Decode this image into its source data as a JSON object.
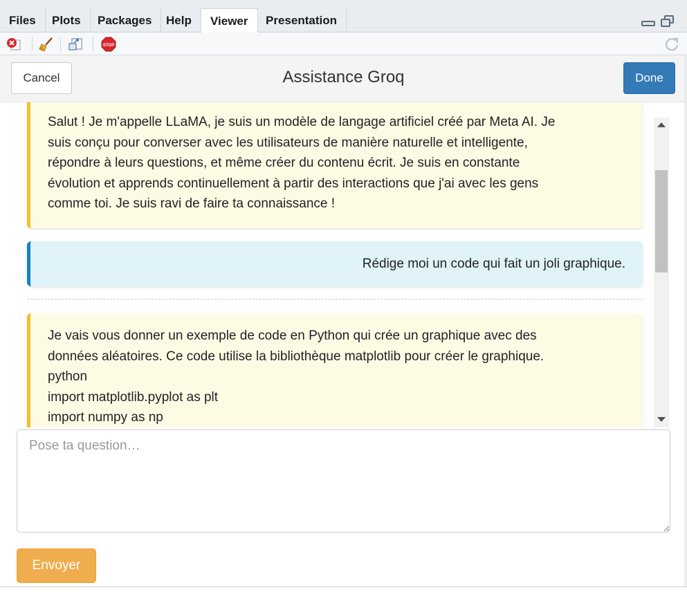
{
  "pane_tabs": [
    "Files",
    "Plots",
    "Packages",
    "Help",
    "Viewer",
    "Presentation"
  ],
  "active_tab": "Viewer",
  "toolbar": {
    "icons": [
      "close-viewer-icon",
      "broom-icon",
      "export-icon",
      "stop-icon",
      "refresh-icon"
    ],
    "stop_label": "STOP"
  },
  "modal": {
    "cancel_label": "Cancel",
    "title": "Assistance Groq",
    "done_label": "Done"
  },
  "messages": [
    {
      "role": "assistant",
      "lines": [
        "Salut ! Je m'appelle LLaMA, je suis un modèle de langage artificiel créé par Meta AI. Je",
        "suis conçu pour converser avec les utilisateurs de manière naturelle et intelligente,",
        "répondre à leurs questions, et même créer du contenu écrit. Je suis en constante",
        "évolution et apprends continuellement à partir des interactions que j'ai avec les gens",
        "comme toi. Je suis ravi de faire ta connaissance !"
      ]
    },
    {
      "role": "user",
      "lines": [
        "Rédige moi un code qui fait un joli graphique."
      ]
    },
    {
      "role": "assistant",
      "lines": [
        "Je vais vous donner un exemple de code en Python qui crée un graphique avec des",
        "données aléatoires. Ce code utilise la bibliothèque matplotlib pour créer le graphique.",
        "python",
        "import matplotlib.pyplot as plt",
        "import numpy as np"
      ]
    }
  ],
  "input": {
    "placeholder": "Pose ta question…",
    "value": ""
  },
  "send_label": "Envoyer",
  "colors": {
    "primary": "#337ab7",
    "warning": "#f0ad4e",
    "assistant_bg": "#fefbe5",
    "assistant_border": "#f4c02b",
    "user_bg": "#dff3f8",
    "user_border": "#1783c5"
  }
}
